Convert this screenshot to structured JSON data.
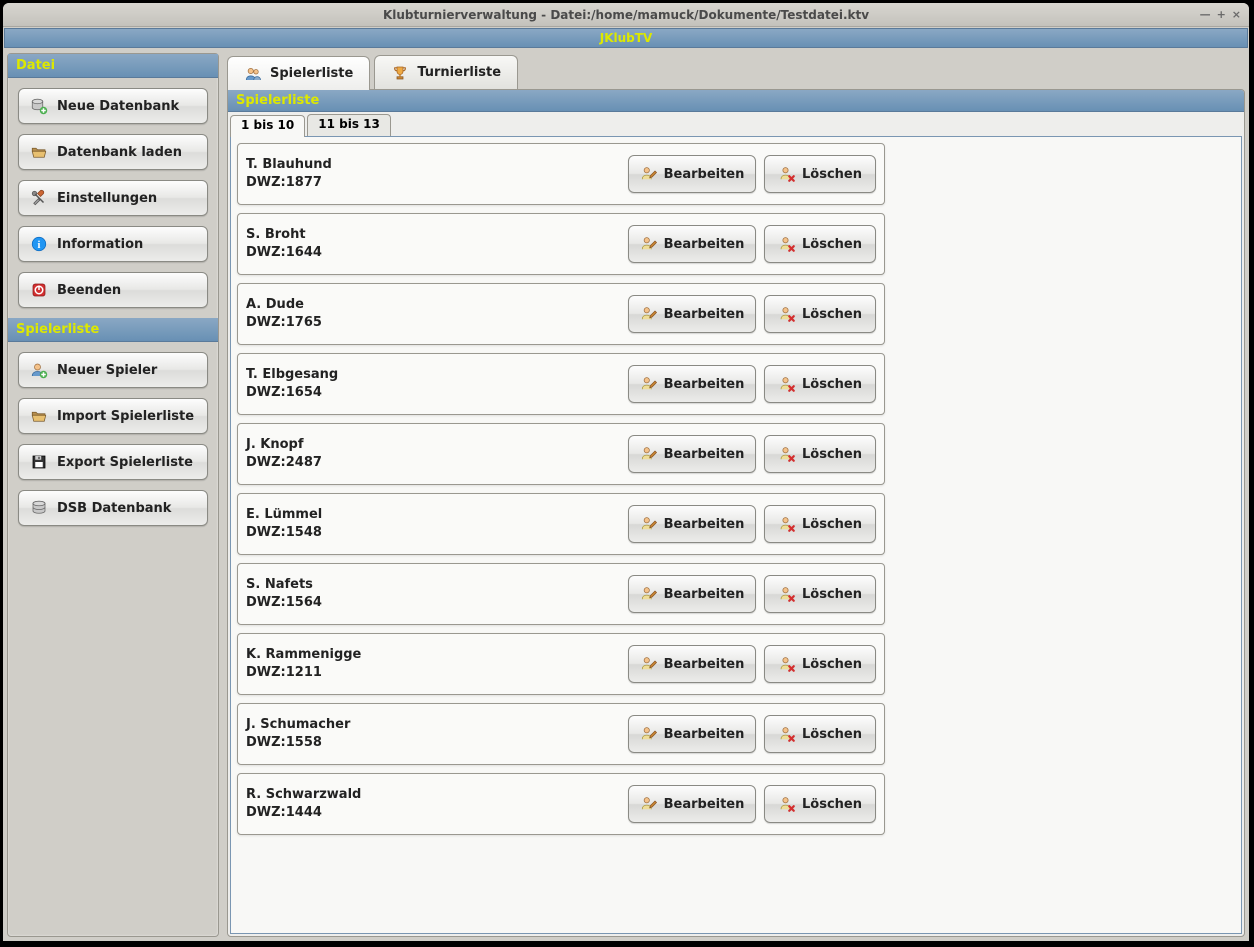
{
  "window": {
    "title": "Klubturnierverwaltung - Datei:/home/mamuck/Dokumente/Testdatei.ktv"
  },
  "app": {
    "name": "JKlubTV"
  },
  "sidebar": {
    "sections": [
      {
        "title": "Datei",
        "buttons": [
          {
            "label": "Neue Datenbank",
            "icon": "database-plus"
          },
          {
            "label": "Datenbank laden",
            "icon": "folder-open"
          },
          {
            "label": "Einstellungen",
            "icon": "tools"
          },
          {
            "label": "Information",
            "icon": "info"
          },
          {
            "label": "Beenden",
            "icon": "power"
          }
        ]
      },
      {
        "title": "Spielerliste",
        "buttons": [
          {
            "label": "Neuer Spieler",
            "icon": "user-plus"
          },
          {
            "label": "Import Spielerliste",
            "icon": "folder-open"
          },
          {
            "label": "Export Spielerliste",
            "icon": "floppy"
          },
          {
            "label": "DSB Datenbank",
            "icon": "database"
          }
        ]
      }
    ]
  },
  "tabs": {
    "items": [
      {
        "label": "Spielerliste",
        "icon": "users",
        "active": true
      },
      {
        "label": "Turnierliste",
        "icon": "trophy",
        "active": false
      }
    ]
  },
  "content": {
    "title": "Spielerliste",
    "pages": [
      {
        "label": "1 bis 10",
        "active": true
      },
      {
        "label": "11 bis 13",
        "active": false
      }
    ],
    "dwz_prefix": "DWZ:",
    "edit_label": "Bearbeiten",
    "delete_label": "Löschen",
    "players": [
      {
        "name": "T. Blauhund",
        "dwz": "1877"
      },
      {
        "name": "S. Broht",
        "dwz": "1644"
      },
      {
        "name": "A. Dude",
        "dwz": "1765"
      },
      {
        "name": "T. Elbgesang",
        "dwz": "1654"
      },
      {
        "name": "J. Knopf",
        "dwz": "2487"
      },
      {
        "name": "E. Lümmel",
        "dwz": "1548"
      },
      {
        "name": "S. Nafets",
        "dwz": "1564"
      },
      {
        "name": "K. Rammenigge",
        "dwz": "1211"
      },
      {
        "name": "J. Schumacher",
        "dwz": "1558"
      },
      {
        "name": "R. Schwarzwald",
        "dwz": "1444"
      }
    ]
  }
}
